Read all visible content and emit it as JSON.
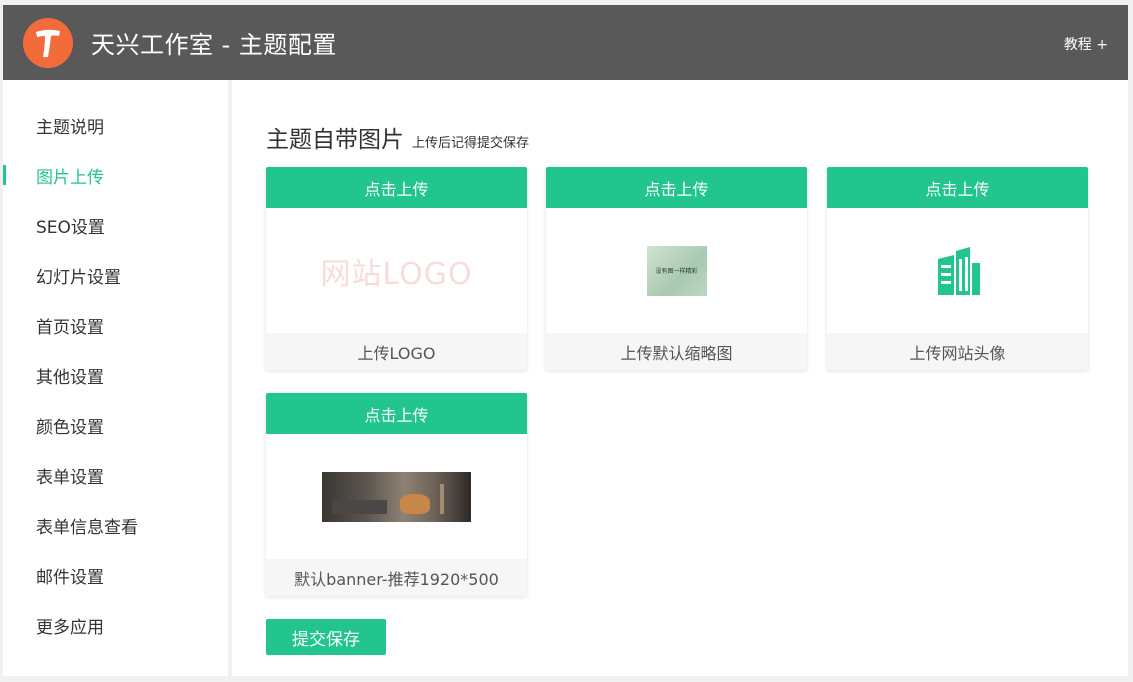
{
  "header": {
    "title": "天兴工作室 - 主题配置",
    "tutorial_link": "教程 +"
  },
  "sidebar": {
    "items": [
      {
        "label": "主题说明"
      },
      {
        "label": "图片上传",
        "active": true
      },
      {
        "label": "SEO设置"
      },
      {
        "label": "幻灯片设置"
      },
      {
        "label": "首页设置"
      },
      {
        "label": "其他设置"
      },
      {
        "label": "颜色设置"
      },
      {
        "label": "表单设置"
      },
      {
        "label": "表单信息查看"
      },
      {
        "label": "邮件设置"
      },
      {
        "label": "更多应用"
      }
    ]
  },
  "main": {
    "title": "主题自带图片",
    "subtitle": "上传后记得提交保存",
    "cards": [
      {
        "button": "点击上传",
        "caption": "上传LOGO",
        "preview_text": "网站LOGO"
      },
      {
        "button": "点击上传",
        "caption": "上传默认缩略图",
        "preview_text": "没有图一样精彩"
      },
      {
        "button": "点击上传",
        "caption": "上传网站头像"
      },
      {
        "button": "点击上传",
        "caption": "默认banner-推荐1920*500"
      }
    ],
    "submit_label": "提交保存"
  },
  "colors": {
    "accent": "#22c58d",
    "header_bg": "#595959",
    "logo_bg": "#f26b3a"
  }
}
